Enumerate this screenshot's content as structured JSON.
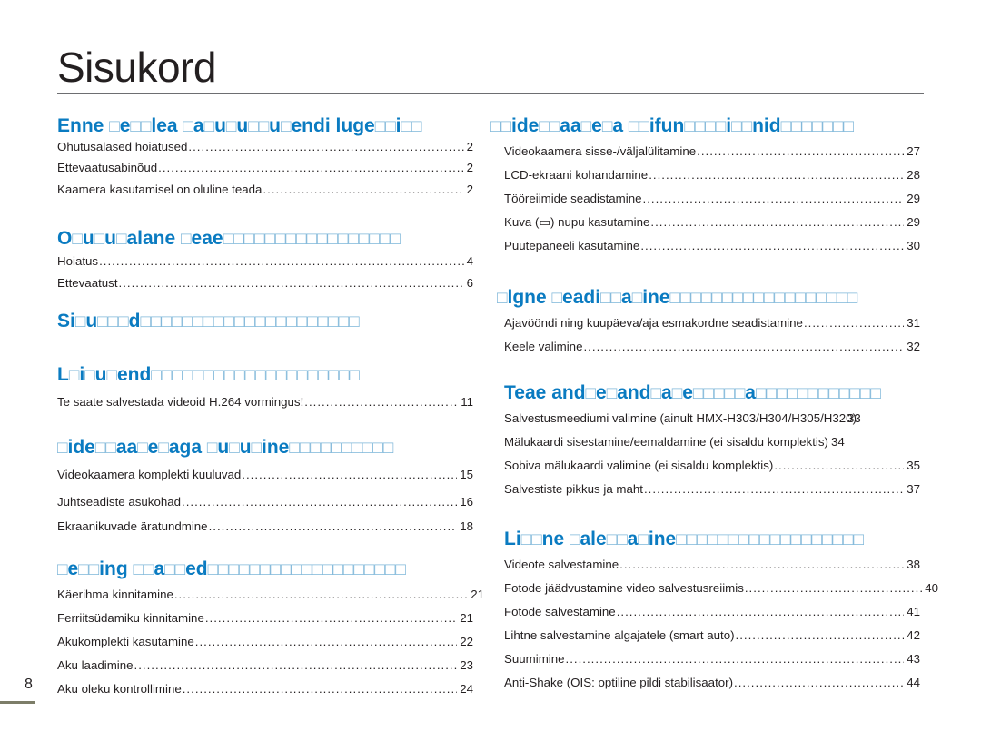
{
  "title": "Sisukord",
  "page_number": "8",
  "left_column": [
    {
      "heading": "Enne □e□□lea □a□u□u□□u□endi luge□□i□□",
      "entries": [
        {
          "label": "Ohutusalased hoiatused",
          "page": "2"
        },
        {
          "label": "Ettevaatusabinõud",
          "page": "2"
        },
        {
          "label": "Kaamera kasutamisel on oluline teada",
          "page": "2"
        }
      ]
    },
    {
      "heading": "O□u□u□alane □eae□□□□□□□□□□□□□□□□□",
      "entries": [
        {
          "label": "Hoiatus",
          "page": "4"
        },
        {
          "label": "Ettevaatust",
          "page": "6"
        }
      ]
    },
    {
      "heading": "Si□u□□□d□□□□□□□□□□□□□□□□□□□□□",
      "entries": []
    },
    {
      "heading": "L□i□u□end□□□□□□□□□□□□□□□□□□□□",
      "entries": [
        {
          "label": "Te saate salvestada videoid H.264 vormingus!",
          "page": "11"
        }
      ]
    },
    {
      "heading": "□ide□□aa□e□aga □u□u□ine□□□□□□□□□□",
      "entries": [
        {
          "label": "Videokaamera komplekti kuuluvad",
          "page": "15"
        },
        {
          "label": "Juhtseadiste asukohad",
          "page": "16"
        },
        {
          "label": "Ekraanikuvade äratundmine",
          "page": "18"
        }
      ]
    },
    {
      "heading": "□e□□ing □□a□□ed□□□□□□□□□□□□□□□□□□□",
      "entries": [
        {
          "label": "Käerihma kinnitamine",
          "page": "21"
        },
        {
          "label": "Ferriitsüdamiku kinnitamine",
          "page": "21"
        },
        {
          "label": "Akukomplekti kasutamine",
          "page": "22"
        },
        {
          "label": "Aku laadimine",
          "page": "23"
        },
        {
          "label": "Aku oleku kontrollimine",
          "page": "24"
        }
      ]
    }
  ],
  "right_column": [
    {
      "heading": "□□ide□□aa□e□a □□ifun□□□□i□□nid□□□□□□□",
      "entries": [
        {
          "label": "Videokaamera sisse-/väljalülitamine",
          "page": "27"
        },
        {
          "label": "LCD-ekraani kohandamine",
          "page": "28"
        },
        {
          "label": "Tööreiimide seadistamine",
          "page": "29"
        },
        {
          "label": "Kuva (▭) nupu kasutamine",
          "page": "29"
        },
        {
          "label": "Puutepaneeli kasutamine",
          "page": "30"
        }
      ]
    },
    {
      "heading": "□lgne □eadi□□a□ine□□□□□□□□□□□□□□□□□□",
      "entries": [
        {
          "label": "Ajavööndi ning kuupäeva/aja esmakordne seadistamine",
          "page": "31"
        },
        {
          "label": "Keele valimine",
          "page": "32"
        }
      ]
    },
    {
      "heading": "Teae and□e□and□a□e□□□□□a□□□□□□□□□□□□",
      "entries": [
        {
          "label": "Salvestusmeediumi valimine (ainult HMX-H303/H304/H305/H320)",
          "page": "33"
        },
        {
          "label": "Mälukaardi sisestamine/eemaldamine (ei sisaldu komplektis)",
          "page": "34"
        },
        {
          "label": "Sobiva mälukaardi valimine (ei sisaldu komplektis)",
          "page": "35"
        },
        {
          "label": "Salvestiste pikkus ja maht",
          "page": "37"
        }
      ]
    },
    {
      "heading": "Li□□ne □ale□□a□ine□□□□□□□□□□□□□□□□□□",
      "entries": [
        {
          "label": "Videote salvestamine",
          "page": "38"
        },
        {
          "label": "Fotode jäädvustamine video salvestusreiimis",
          "page": "40"
        },
        {
          "label": "Fotode salvestamine",
          "page": "41"
        },
        {
          "label": "Lihtne salvestamine algajatele (smart auto)",
          "page": "42"
        },
        {
          "label": "Suumimine",
          "page": "43"
        },
        {
          "label": "Anti-Shake (OIS: optiline pildi stabilisaator)",
          "page": "44"
        }
      ]
    }
  ]
}
